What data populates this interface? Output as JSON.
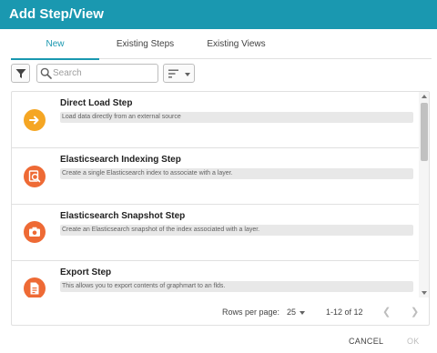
{
  "dialog": {
    "title": "Add Step/View"
  },
  "tabs": [
    {
      "label": "New",
      "active": true
    },
    {
      "label": "Existing Steps",
      "active": false
    },
    {
      "label": "Existing Views",
      "active": false
    }
  ],
  "toolbar": {
    "filter_icon": "filter-icon",
    "search_placeholder": "Search",
    "search_value": "",
    "sort_icon": "sort-icon"
  },
  "steps": [
    {
      "title": "Direct Load Step",
      "description": "Load data directly from an external source",
      "icon": "arrow-right-icon",
      "color": "#f5a623"
    },
    {
      "title": "Elasticsearch Indexing Step",
      "description": "Create a single Elasticsearch index to associate with a layer.",
      "icon": "search-index-icon",
      "color": "#ee6a35"
    },
    {
      "title": "Elasticsearch Snapshot Step",
      "description": "Create an Elasticsearch snapshot of the index associated with a layer.",
      "icon": "camera-icon",
      "color": "#ee6a35"
    },
    {
      "title": "Export Step",
      "description": "This allows you to export contents of graphmart to an flds.",
      "icon": "export-file-icon",
      "color": "#ee6a35"
    }
  ],
  "pagination": {
    "rows_per_page_label": "Rows per page:",
    "rows_per_page_value": "25",
    "range": "1-12 of 12"
  },
  "actions": {
    "cancel_label": "CANCEL",
    "ok_label": "OK"
  },
  "colors": {
    "accent": "#1a98b0",
    "direct_load": "#f5a623",
    "elasticsearch": "#ee6a35"
  }
}
